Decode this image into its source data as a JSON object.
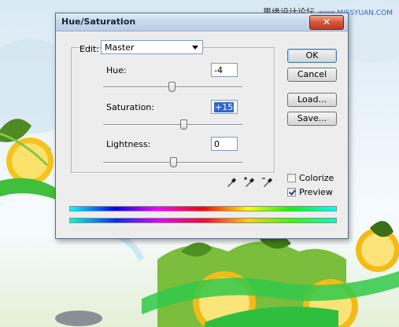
{
  "watermark": {
    "text": "思缘设计论坛",
    "site": "www.MISSYUAN.COM"
  },
  "dialog": {
    "title": "Hue/Saturation",
    "close_label": "✕",
    "edit": {
      "label": "Edit:",
      "value": "Master"
    },
    "hue": {
      "label": "Hue:",
      "value": "-4",
      "range": [
        -180,
        180
      ]
    },
    "saturation": {
      "label": "Saturation:",
      "value": "+15",
      "range": [
        -100,
        100
      ]
    },
    "lightness": {
      "label": "Lightness:",
      "value": "0",
      "range": [
        -100,
        100
      ]
    },
    "buttons": {
      "ok": "OK",
      "cancel": "Cancel",
      "load": "Load...",
      "save": "Save..."
    },
    "colorize": {
      "label": "Colorize",
      "checked": false
    },
    "preview": {
      "label": "Preview",
      "checked": true
    },
    "droppers": [
      "eyedropper-icon",
      "eyedropper-plus-icon",
      "eyedropper-minus-icon"
    ]
  }
}
